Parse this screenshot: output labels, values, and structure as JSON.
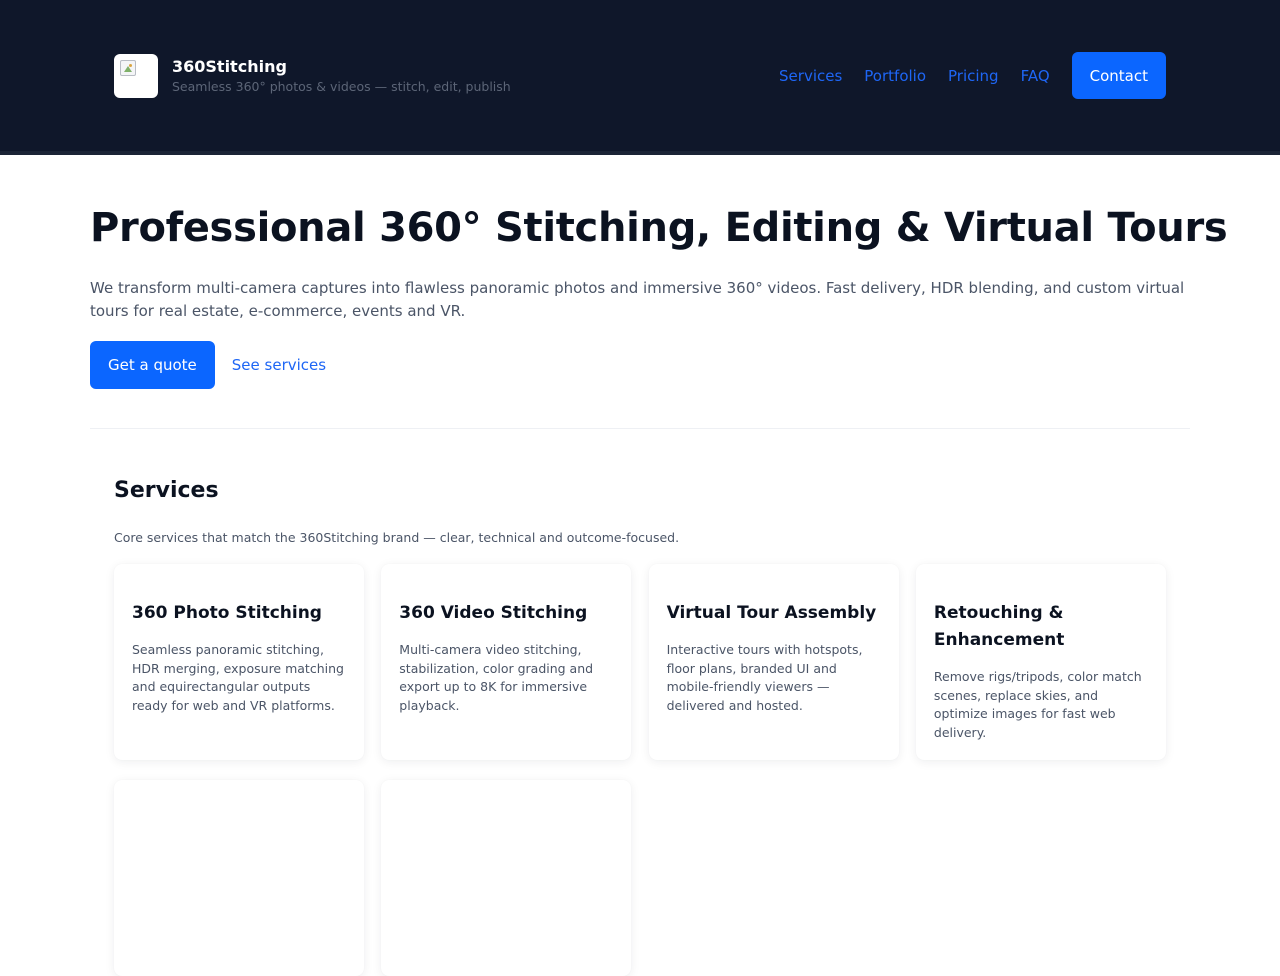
{
  "header": {
    "brand_name": "360Stitching",
    "tagline": "Seamless 360° photos & videos — stitch, edit, publish",
    "logo_icon": "broken-image-icon",
    "nav": [
      {
        "label": "Services"
      },
      {
        "label": "Portfolio"
      },
      {
        "label": "Pricing"
      },
      {
        "label": "FAQ"
      }
    ],
    "contact_label": "Contact"
  },
  "hero": {
    "title": "Professional 360° Stitching, Editing & Virtual Tours",
    "subtitle": "We transform multi-camera captures into flawless panoramic photos and immersive 360° videos. Fast delivery, HDR blending, and custom virtual tours for real estate, e-commerce, events and VR.",
    "primary_cta": "Get a quote",
    "secondary_cta": "See services"
  },
  "services": {
    "title": "Services",
    "subtitle": "Core services that match the 360Stitching brand — clear, technical and outcome-focused.",
    "cards": [
      {
        "title": "360 Photo Stitching",
        "description": "Seamless panoramic stitching, HDR merging, exposure matching and equirectangular outputs ready for web and VR platforms."
      },
      {
        "title": "360 Video Stitching",
        "description": "Multi-camera video stitching, stabilization, color grading and export up to 8K for immersive playback."
      },
      {
        "title": "Virtual Tour Assembly",
        "description": "Interactive tours with hotspots, floor plans, branded UI and mobile-friendly viewers — delivered and hosted."
      },
      {
        "title": "Retouching & Enhancement",
        "description": "Remove rigs/tripods, color match scenes, replace skies, and optimize images for fast web delivery."
      },
      {
        "title": "",
        "description": ""
      },
      {
        "title": "",
        "description": ""
      }
    ]
  },
  "colors": {
    "header_bg": "#0f172a",
    "accent": "#0b66ff",
    "link": "#1e66f5",
    "text_dark": "#0b1220",
    "text_muted": "#4b5567"
  }
}
